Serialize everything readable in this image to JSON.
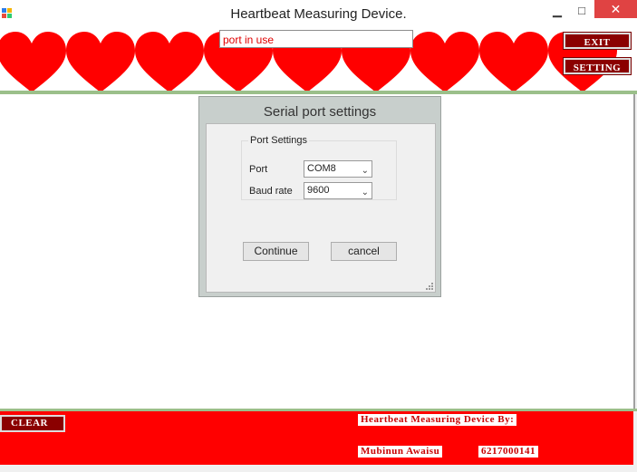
{
  "window": {
    "title": "Heartbeat Measuring Device.",
    "minimize_glyph": "▁",
    "maximize_glyph": "□",
    "close_glyph": "✕"
  },
  "header": {
    "status_text": "port in use",
    "exit_label": "EXIT",
    "setting_label": "SETTING"
  },
  "dialog": {
    "title": "Serial port settings",
    "group_label": "Port Settings",
    "port_label": "Port",
    "port_value": "COM8",
    "baud_label": "Baud rate",
    "baud_value": "9600",
    "continue_label": "Continue",
    "cancel_label": "cancel"
  },
  "footer": {
    "clear_label": "CLEAR",
    "credit_heading": "Heartbeat Measuring Device By:",
    "author_name": "Mubinun Awaisu",
    "author_id": "6217000141"
  },
  "colors": {
    "heart": "#ff0000",
    "button_dark_red": "#8b0000",
    "footer_red": "#ff0000",
    "accent_green": "#9bbf8a",
    "status_text": "#e00000"
  },
  "icons": {
    "app": "app-icon",
    "heart": "heart-icon",
    "dropdown": "chevron-down-icon",
    "resize": "resize-grip-icon"
  }
}
